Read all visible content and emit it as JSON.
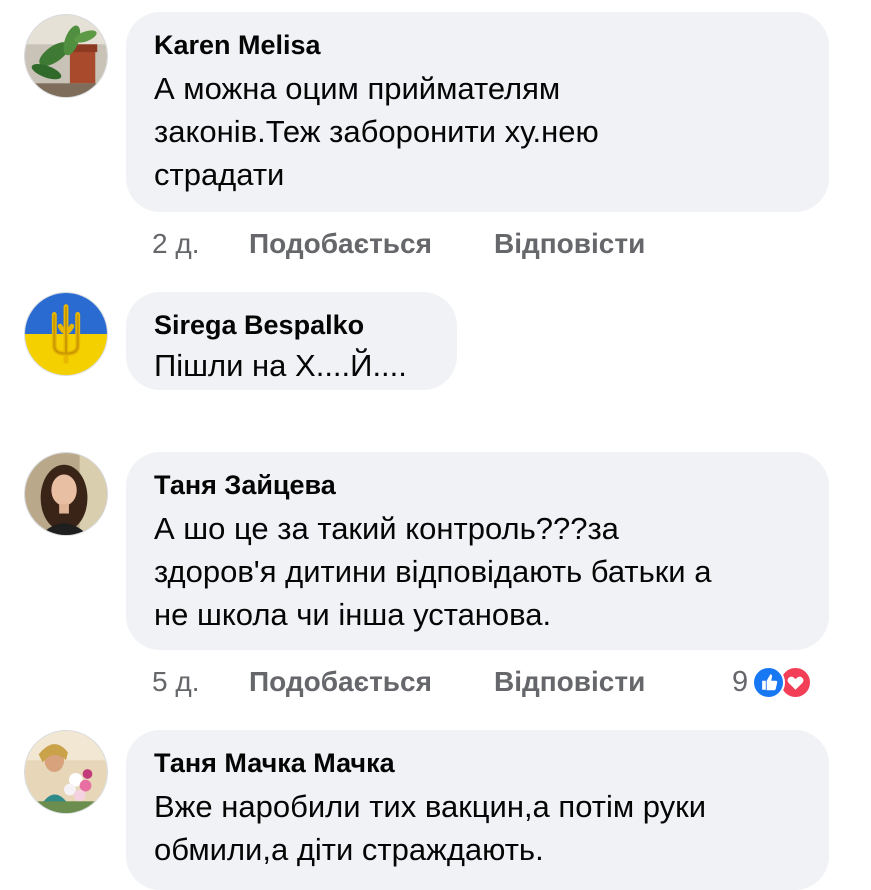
{
  "comments": [
    {
      "author": "Karen Melisa",
      "lines": [
        "А можна оцим приймателям",
        "законів.Теж заборонити ху.нею",
        "страдати"
      ],
      "time": "2 д.",
      "like_label": "Подобається",
      "reply_label": "Відповісти",
      "avatar_icon": "plant-photo-avatar"
    },
    {
      "author": "Sirega Bespalko",
      "lines": [
        "Пішли на Х....Й...."
      ],
      "avatar_icon": "ukraine-trident-avatar"
    },
    {
      "author": "Таня Зайцева",
      "lines": [
        "А шо це за такий контроль???за",
        "здоров'я дитини відповідають батьки а",
        "не школа чи інша установа."
      ],
      "time": "5 д.",
      "like_label": "Подобається",
      "reply_label": "Відповісти",
      "reaction_count": "9",
      "reaction_icons": [
        "like-reaction-icon",
        "love-reaction-icon"
      ],
      "avatar_icon": "woman-portrait-avatar"
    },
    {
      "author": "Таня Мачка Мачка",
      "lines": [
        "Вже наробили тих вакцин,а потім руки",
        "обмили,а діти страждають."
      ],
      "avatar_icon": "woman-with-flowers-avatar"
    }
  ],
  "colors": {
    "bubble": "#f0f2f5",
    "meta_text": "#65676b",
    "like_blue": "#1877f2",
    "love_red": "#f33e58"
  }
}
